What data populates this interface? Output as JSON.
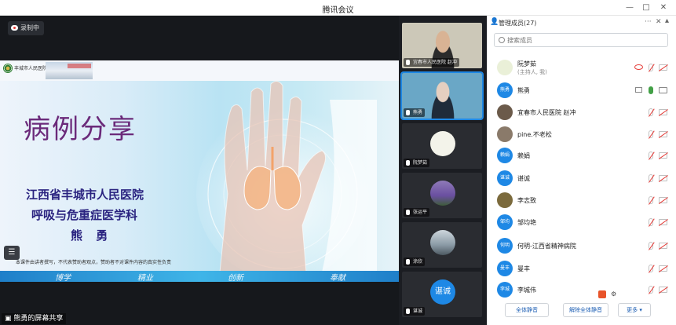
{
  "window": {
    "title": "腾讯会议"
  },
  "stage": {
    "recording_label": "录制中",
    "share_label": "熊勇的屏幕共享",
    "slide": {
      "logo_text": "丰城市人民医院",
      "title": "病例分享",
      "subtitle_1": "江西省丰城市人民医院",
      "subtitle_2": "呼吸与危重症医学科",
      "presenter": "熊 勇",
      "note": "本课件由讲者撰写，不代表赞助者观点，赞助者不对课件内容的真实性负责",
      "footer": [
        "博学",
        "精业",
        "创新",
        "奉献"
      ]
    }
  },
  "thumbnails": [
    {
      "name": "宜春市人民医院 赵冲",
      "type": "camera"
    },
    {
      "name": "熊勇",
      "type": "camera",
      "active": true
    },
    {
      "name": "阮梦茹",
      "type": "avatar"
    },
    {
      "name": "张运平",
      "type": "avatar"
    },
    {
      "name": "涂欣",
      "type": "avatar"
    },
    {
      "name": "谌诚",
      "type": "text-avatar",
      "initials": "谌诚"
    }
  ],
  "panel": {
    "title": "管理成员(27)",
    "search_placeholder": "搜索成员",
    "members": [
      {
        "name": "阮梦茹",
        "sub": "(主持人, 我)",
        "avatar": "",
        "mic": "off",
        "cam": "off",
        "extra": "eye"
      },
      {
        "name": "熊勇",
        "avatar": "熊勇",
        "mic": "on",
        "cam": "on",
        "extra": "screen"
      },
      {
        "name": "宜春市人民医院 赵冲",
        "avatar": "",
        "mic": "off",
        "cam": "off"
      },
      {
        "name": "pine.不老松",
        "avatar": "",
        "mic": "off",
        "cam": "off"
      },
      {
        "name": "赖娟",
        "avatar": "赖娟",
        "mic": "off",
        "cam": "off"
      },
      {
        "name": "谌诚",
        "avatar": "谌诚",
        "mic": "off",
        "cam": "off"
      },
      {
        "name": "李志致",
        "avatar": "",
        "mic": "off",
        "cam": "off"
      },
      {
        "name": "邹均艳",
        "avatar": "邹均",
        "mic": "off",
        "cam": "off"
      },
      {
        "name": "何明-江西省精神病院",
        "avatar": "何明",
        "mic": "off",
        "cam": "off"
      },
      {
        "name": "曼丰",
        "avatar": "曼丰",
        "mic": "off",
        "cam": "off"
      },
      {
        "name": "李城伟",
        "avatar": "李城",
        "mic": "off",
        "cam": "off"
      }
    ],
    "footer": {
      "mute_all": "全体静音",
      "unmute_all": "解除全体静音",
      "more": "更多"
    }
  }
}
